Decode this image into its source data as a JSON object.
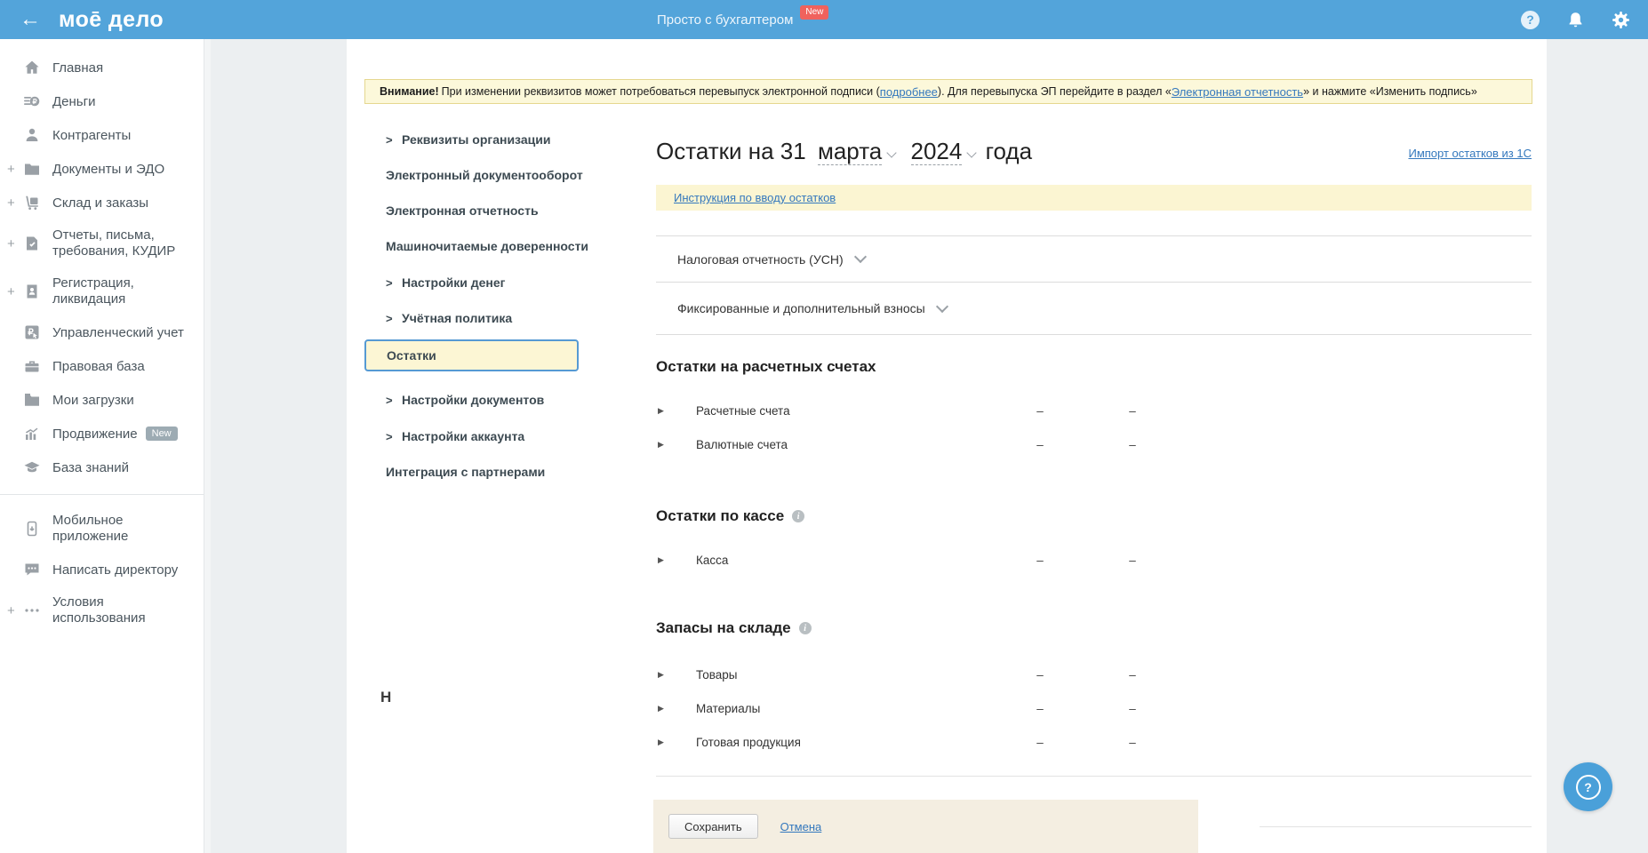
{
  "ui_glyphs": {
    "back": "←",
    "plus": "+",
    "triangle": "▶",
    "submenu_chevron": ">",
    "info": "i",
    "help": "?"
  },
  "topbar": {
    "logo": "моē дело",
    "tagline": "Просто с бухгалтером",
    "tagline_badge": "New"
  },
  "sidebar": {
    "items": [
      {
        "label": "Главная"
      },
      {
        "label": "Деньги"
      },
      {
        "label": "Контрагенты"
      },
      {
        "label": "Документы и ЭДО",
        "expandable": true
      },
      {
        "label": "Склад и заказы",
        "expandable": true
      },
      {
        "label": "Отчеты, письма,",
        "label2": "требования, КУДИР",
        "expandable": true
      },
      {
        "label": "Регистрация,",
        "label2": "ликвидация",
        "expandable": true
      },
      {
        "label": "Управленческий учет"
      },
      {
        "label": "Правовая база"
      },
      {
        "label": "Мои загрузки"
      },
      {
        "label": "Продвижение",
        "badge": "New"
      },
      {
        "label": "База знаний"
      },
      {
        "label": "Мобильное",
        "label2": "приложение"
      },
      {
        "label": "Написать директору"
      },
      {
        "label": "Условия",
        "label2": "использования",
        "expandable": true
      }
    ]
  },
  "submenu": {
    "items": [
      {
        "label": "Реквизиты организации",
        "chevron": true
      },
      {
        "label": "Электронный документооборот"
      },
      {
        "label": "Электронная отчетность"
      },
      {
        "label": "Машиночитаемые доверенности"
      },
      {
        "label": "Настройки денег",
        "chevron": true
      },
      {
        "label": "Учётная политика",
        "chevron": true
      },
      {
        "label": "Остатки",
        "selected": true
      },
      {
        "label": "Настройки документов",
        "chevron": true
      },
      {
        "label": "Настройки аккаунта",
        "chevron": true
      },
      {
        "label": "Интеграция с партнерами"
      }
    ]
  },
  "warning": {
    "bold": "Внимание!",
    "text1": " При изменении реквизитов может потребоваться перевыпуск электронной подписи (",
    "link1": "подробнее",
    "text2": "). Для перевыпуска ЭП перейдите в раздел «",
    "link2": "Электронная отчетность",
    "text3": "» и нажмите «Изменить подпись»"
  },
  "main": {
    "title_prefix": "Остатки на 31",
    "title_month": "марта",
    "title_year": "2024",
    "title_suffix": "года",
    "import_link": "Импорт остатков из 1С",
    "instruction_link": "Инструкция по вводу остатков",
    "collapsibles": [
      {
        "label": "Налоговая отчетность (УСН)"
      },
      {
        "label": "Фиксированные и дополнительный взносы"
      }
    ],
    "sections": [
      {
        "heading": "Остатки на расчетных счетах",
        "info": false,
        "rows": [
          {
            "label": "Расчетные счета",
            "values": [
              "–",
              "–"
            ]
          },
          {
            "label": "Валютные счета",
            "values": [
              "–",
              "–"
            ]
          }
        ]
      },
      {
        "heading": "Остатки по кассе",
        "info": true,
        "rows": [
          {
            "label": "Касса",
            "values": [
              "–",
              "–"
            ]
          }
        ]
      },
      {
        "heading": "Запасы на складе",
        "info": true,
        "rows": [
          {
            "label": "Товары",
            "values": [
              "–",
              "–"
            ]
          },
          {
            "label": "Материалы",
            "values": [
              "–",
              "–"
            ]
          },
          {
            "label": "Готовая продукция",
            "values": [
              "–",
              "–"
            ]
          }
        ]
      }
    ],
    "partial_heading": "Н"
  },
  "footer": {
    "save": "Сохранить",
    "cancel": "Отмена"
  },
  "colors": {
    "topbar_blue": "#53a4da",
    "badge_red": "#f0625d",
    "link_blue": "#3478bd",
    "selected_bg": "#fcf6d4",
    "selected_border": "#569ad3",
    "warning_bg": "#fcf8da",
    "warning_border": "#e5d78f",
    "instruction_bg": "#fbf5d2",
    "footer_bar_bg": "#f4eee1",
    "page_bg": "#eceff1"
  }
}
